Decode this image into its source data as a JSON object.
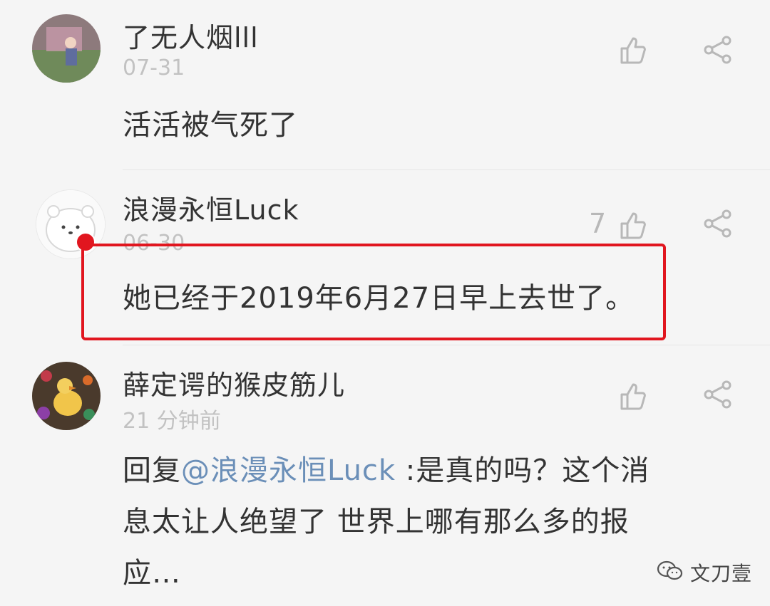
{
  "comments": [
    {
      "username": "了无人烟lll",
      "time": "07-31",
      "text": "活活被气死了",
      "like_count": ""
    },
    {
      "username": "浪漫永恒Luck",
      "time": "06-30",
      "text": "她已经于2019年6月27日早上去世了。",
      "like_count": "7"
    },
    {
      "username": "薛定谔的猴皮筋儿",
      "time": "21 分钟前",
      "reply_prefix": "回复",
      "mention": "@浪漫永恒Luck",
      "text_line1_rest": " :是真的吗？这个消",
      "text_line2": "息太让人绝望了 世界上哪有那么多的报",
      "text_line3": "应…"
    }
  ],
  "watermark": {
    "label": "文刀壹"
  },
  "colors": {
    "highlight": "#e1161f",
    "mention": "#6b8fb8",
    "meta": "#c2c2c2"
  },
  "icons": [
    "thumb-up-icon",
    "share-icon",
    "wechat-icon"
  ]
}
